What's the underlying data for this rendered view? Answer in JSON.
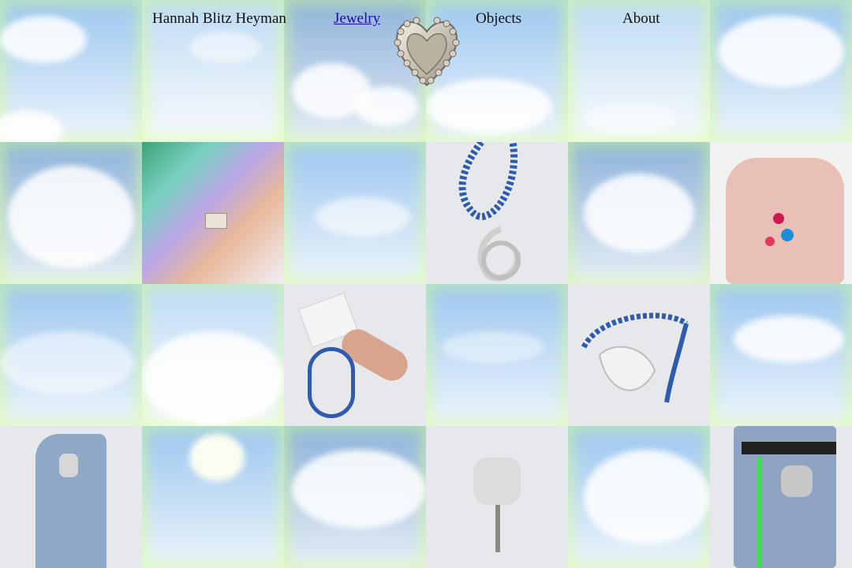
{
  "nav": {
    "brand": "Hannah Blitz Heyman",
    "links": [
      "Jewelry",
      "Objects",
      "About"
    ],
    "active": "Jewelry"
  },
  "colors": {
    "glow": "#d6ff96",
    "link": "#1a0dab",
    "sky": "#9cc7f0",
    "product_bg": "#e6e8ec"
  },
  "icons": [
    "heart-logo-icon"
  ]
}
